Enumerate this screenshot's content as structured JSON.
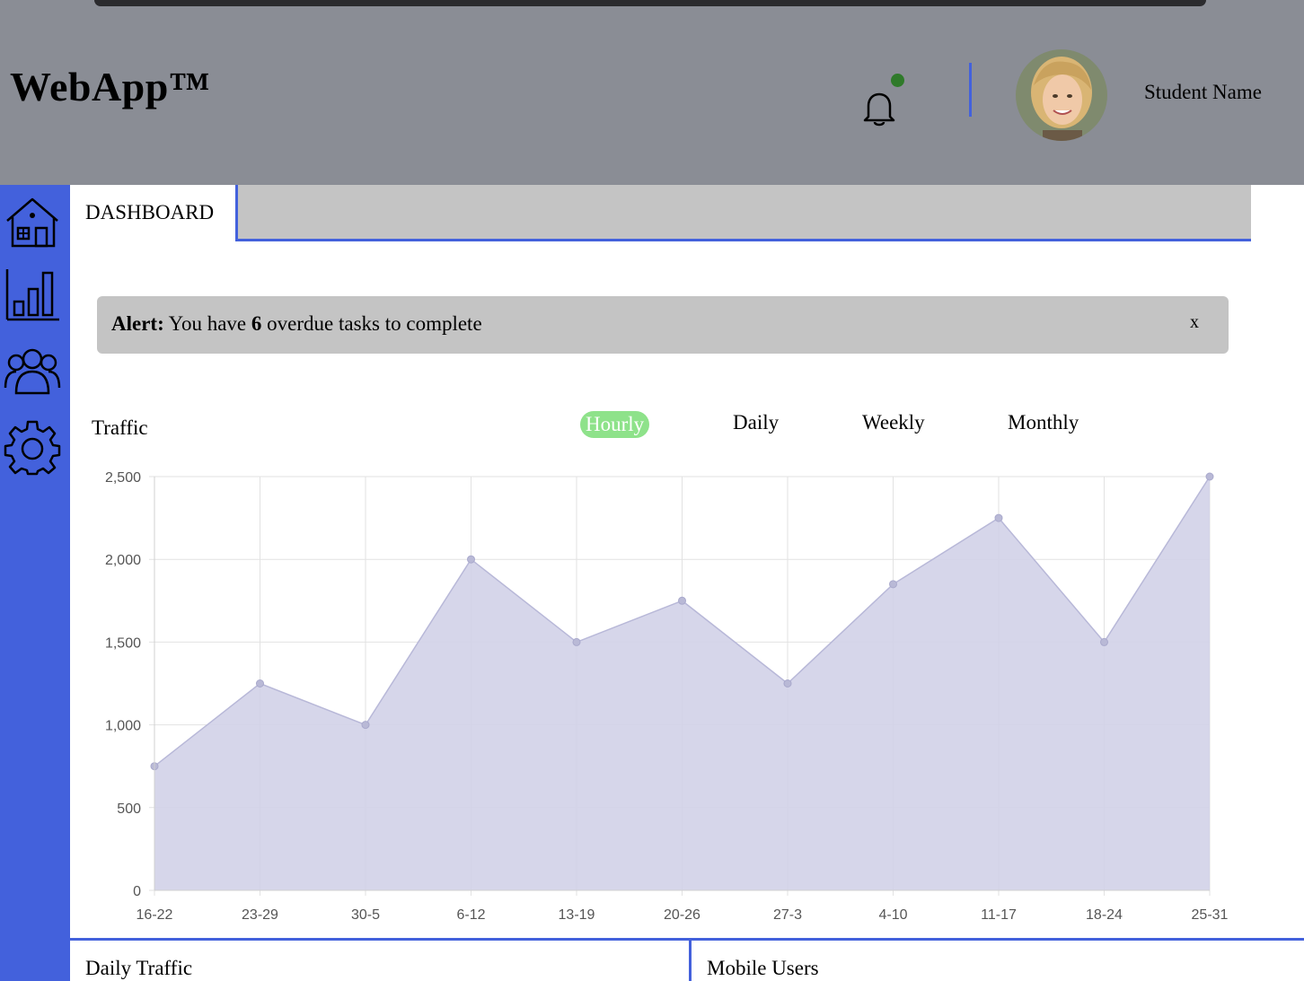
{
  "header": {
    "brand": "WebApp™",
    "user_name": "Student Name",
    "notification_icon": "bell-icon",
    "status_color": "#2f7a2a"
  },
  "sidebar": {
    "items": [
      {
        "icon": "home-icon"
      },
      {
        "icon": "bar-chart-icon"
      },
      {
        "icon": "users-icon"
      },
      {
        "icon": "gear-icon"
      }
    ]
  },
  "tabs": {
    "active": "DASHBOARD"
  },
  "alert": {
    "label": "Alert:",
    "prefix": "You have",
    "count": "6",
    "suffix": "overdue tasks to complete",
    "close": "x"
  },
  "traffic": {
    "title": "Traffic",
    "filters": [
      "Hourly",
      "Daily",
      "Weekly",
      "Monthly"
    ],
    "active_filter": "Hourly"
  },
  "chart_data": {
    "type": "area",
    "categories": [
      "16-22",
      "23-29",
      "30-5",
      "6-12",
      "13-19",
      "20-26",
      "27-3",
      "4-10",
      "11-17",
      "18-24",
      "25-31"
    ],
    "values": [
      750,
      1250,
      1000,
      2000,
      1500,
      1750,
      1250,
      1850,
      2250,
      1500,
      2500
    ],
    "yticks": [
      "0",
      "500",
      "1,000",
      "1,500",
      "2,000",
      "2,500"
    ],
    "ylim": [
      0,
      2500
    ],
    "grid": true,
    "fill_color": "#d2d2e8",
    "line_color": "#b8b8d8"
  },
  "bottom": {
    "left_title": "Daily Traffic",
    "right_title": "Mobile Users"
  },
  "colors": {
    "accent": "#4361dc",
    "header_bg": "#8a8d95",
    "active_filter": "#8ee28a"
  }
}
